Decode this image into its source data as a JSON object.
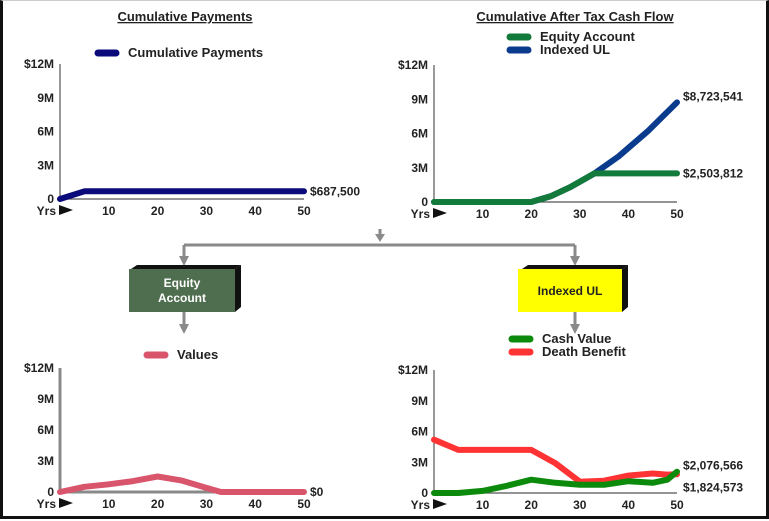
{
  "flow": {
    "boxes": [
      {
        "label_lines": [
          "Equity",
          "Account"
        ],
        "fill": "#4f6e4f",
        "text_color": "#ffffff"
      },
      {
        "label_lines": [
          "Indexed UL"
        ],
        "fill": "#ffff00",
        "text_color": "#222222"
      }
    ]
  },
  "chart_data": [
    {
      "id": "cumulative-payments",
      "type": "line",
      "title": "Cumulative Payments",
      "xlabel": "Yrs",
      "ylabel": "",
      "xlim": [
        0,
        50
      ],
      "ylim": [
        0,
        12000000
      ],
      "xticks": [
        "10",
        "20",
        "30",
        "40",
        "50"
      ],
      "xtick_values": [
        10,
        20,
        30,
        40,
        50
      ],
      "yticks": [
        "0",
        "3M",
        "6M",
        "9M",
        "$12M"
      ],
      "ytick_values": [
        0,
        3000000,
        6000000,
        9000000,
        12000000
      ],
      "legend": "top-center",
      "series": [
        {
          "name": "Cumulative Payments",
          "color": "#0a0a7a",
          "x": [
            0,
            5,
            10,
            20,
            30,
            40,
            50
          ],
          "values": [
            0,
            687500,
            687500,
            687500,
            687500,
            687500,
            687500
          ],
          "end_label": "$687,500"
        }
      ]
    },
    {
      "id": "cumulative-after-tax-cash-flow",
      "type": "line",
      "title": "Cumulative After Tax Cash Flow",
      "xlabel": "Yrs",
      "ylabel": "",
      "xlim": [
        0,
        50
      ],
      "ylim": [
        0,
        12000000
      ],
      "xticks": [
        "10",
        "20",
        "30",
        "40",
        "50"
      ],
      "xtick_values": [
        10,
        20,
        30,
        40,
        50
      ],
      "yticks": [
        "0",
        "3M",
        "6M",
        "9M",
        "$12M"
      ],
      "ytick_values": [
        0,
        3000000,
        6000000,
        9000000,
        12000000
      ],
      "legend": "top-center",
      "series": [
        {
          "name": "Indexed UL",
          "color": "#0b3b8c",
          "x": [
            0,
            20,
            24,
            28,
            33,
            38,
            44,
            50
          ],
          "values": [
            0,
            0,
            500000,
            1300000,
            2500000,
            4000000,
            6200000,
            8723541
          ],
          "end_label": "$8,723,541"
        },
        {
          "name": "Equity Account",
          "color": "#127a3a",
          "x": [
            0,
            20,
            24,
            28,
            33,
            40,
            50
          ],
          "values": [
            0,
            0,
            500000,
            1300000,
            2503812,
            2503812,
            2503812
          ],
          "end_label": "$2,503,812"
        }
      ]
    },
    {
      "id": "equity-account-values",
      "type": "line",
      "title": "",
      "xlabel": "Yrs",
      "ylabel": "",
      "xlim": [
        0,
        50
      ],
      "ylim": [
        0,
        12000000
      ],
      "xticks": [
        "10",
        "20",
        "30",
        "40",
        "50"
      ],
      "xtick_values": [
        10,
        20,
        30,
        40,
        50
      ],
      "yticks": [
        "0",
        "3M",
        "6M",
        "9M",
        "$12M"
      ],
      "ytick_values": [
        0,
        3000000,
        6000000,
        9000000,
        12000000
      ],
      "legend": "top-center",
      "series": [
        {
          "name": "Values",
          "color": "#d9556b",
          "x": [
            0,
            5,
            10,
            15,
            20,
            25,
            30,
            33,
            40,
            50
          ],
          "values": [
            0,
            500000,
            750000,
            1050000,
            1500000,
            1100000,
            400000,
            0,
            0,
            0
          ],
          "end_label": "$0"
        }
      ]
    },
    {
      "id": "indexed-ul-values",
      "type": "line",
      "title": "",
      "xlabel": "Yrs",
      "ylabel": "",
      "xlim": [
        0,
        50
      ],
      "ylim": [
        0,
        12000000
      ],
      "xticks": [
        "10",
        "20",
        "30",
        "40",
        "50"
      ],
      "xtick_values": [
        10,
        20,
        30,
        40,
        50
      ],
      "yticks": [
        "0",
        "3M",
        "6M",
        "9M",
        "$12M"
      ],
      "ytick_values": [
        0,
        3000000,
        6000000,
        9000000,
        12000000
      ],
      "legend": "top-center",
      "series": [
        {
          "name": "Death Benefit",
          "color": "#ff3333",
          "x": [
            0,
            5,
            10,
            15,
            20,
            25,
            30,
            35,
            40,
            45,
            48,
            50
          ],
          "values": [
            5200000,
            4200000,
            4200000,
            4200000,
            4200000,
            2900000,
            1100000,
            1200000,
            1700000,
            1900000,
            1800000,
            1824573
          ],
          "end_label": "$1,824,573"
        },
        {
          "name": "Cash Value",
          "color": "#0c8a0c",
          "x": [
            0,
            5,
            10,
            15,
            20,
            25,
            30,
            35,
            40,
            45,
            48,
            50
          ],
          "values": [
            0,
            0,
            200000,
            700000,
            1300000,
            1000000,
            800000,
            800000,
            1150000,
            1000000,
            1300000,
            2076566
          ],
          "end_label": "$2,076,566"
        }
      ]
    }
  ]
}
